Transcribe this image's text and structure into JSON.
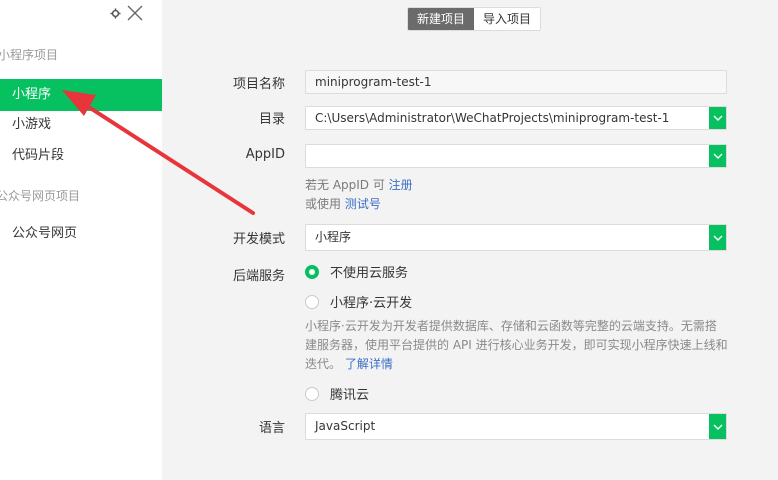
{
  "sidebar": {
    "sections": [
      {
        "title": "小程序项目",
        "items": [
          {
            "label": "小程序",
            "active": true
          },
          {
            "label": "小游戏"
          },
          {
            "label": "代码片段"
          }
        ]
      },
      {
        "title": "公众号网页项目",
        "items": [
          {
            "label": "公众号网页"
          }
        ]
      }
    ]
  },
  "tabs": [
    {
      "label": "新建项目",
      "active": true
    },
    {
      "label": "导入项目"
    }
  ],
  "form": {
    "project_name": {
      "label": "项目名称",
      "value": "miniprogram-test-1"
    },
    "directory": {
      "label": "目录",
      "value": "C:\\Users\\Administrator\\WeChatProjects\\miniprogram-test-1"
    },
    "appid": {
      "label": "AppID",
      "value": ""
    },
    "appid_hint": {
      "line1_prefix": "若无 AppID 可 ",
      "register_link": "注册",
      "line2_prefix": "或使用 ",
      "test_link": "测试号"
    },
    "dev_mode": {
      "label": "开发模式",
      "value": "小程序"
    },
    "backend": {
      "label": "后端服务",
      "options": [
        {
          "label": "不使用云服务",
          "checked": true
        },
        {
          "label": "小程序·云开发",
          "checked": false
        },
        {
          "label": "腾讯云",
          "checked": false
        }
      ],
      "desc_line1": "小程序·云开发为开发者提供数据库、存储和云函数等完整的云端支持。无需搭",
      "desc_line2": "建服务器，使用平台提供的 API 进行核心业务开发，即可实现小程序快速上线和",
      "desc_line3": "迭代。",
      "desc_link": "了解详情"
    },
    "language": {
      "label": "语言",
      "value": "JavaScript"
    }
  },
  "colors": {
    "accent": "#07c160",
    "link": "#3b6fc6",
    "annotation_arrow": "#e8353b"
  },
  "icons": {
    "settings": "gear-icon",
    "close": "close-icon",
    "dropdown": "chevron-down-icon"
  }
}
